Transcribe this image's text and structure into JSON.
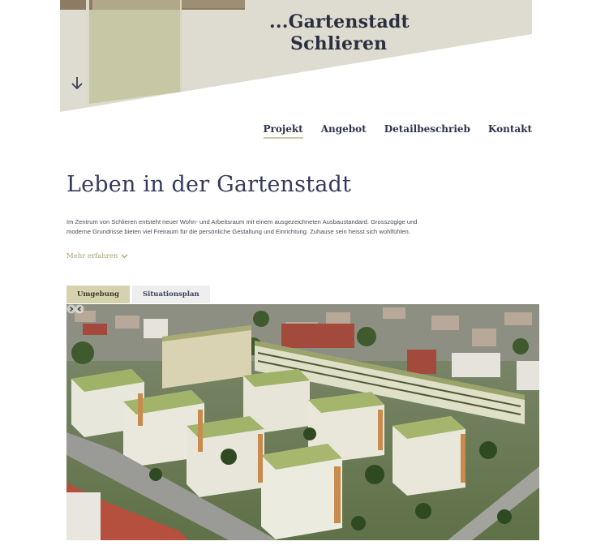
{
  "brand": {
    "line1": "...Gartenstadt",
    "line2": "Schlieren"
  },
  "nav": [
    {
      "label": "Projekt",
      "active": true
    },
    {
      "label": "Angebot",
      "active": false
    },
    {
      "label": "Detailbeschrieb",
      "active": false
    },
    {
      "label": "Kontakt",
      "active": false
    }
  ],
  "main": {
    "title": "Leben in der Gartenstadt",
    "intro": "Im Zentrum von Schlieren entsteht neuer Wohn- und Arbeitsraum mit einem ausgezeichneten Ausbaustandard. Grosszügige und moderne Grundrisse bieten viel Freiraum für die persönliche Gestaltung und Einrichtung. Zuhause sein heisst sich wohlfühlen.",
    "more_label": "Mehr erfahren"
  },
  "tabs": [
    {
      "label": "Umgebung",
      "active": true
    },
    {
      "label": "Situationsplan",
      "active": false
    }
  ],
  "colors": {
    "accent_olive": "#c9c7a7",
    "tab_active": "#d7d2ae",
    "title": "#343a5c",
    "more_link": "#a7a06b"
  },
  "icons": {
    "scroll_down": "arrow-down-icon",
    "more": "chevron-down-icon",
    "gallery_prev": "chevron-left-icon",
    "gallery_next": "chevron-right-icon"
  }
}
